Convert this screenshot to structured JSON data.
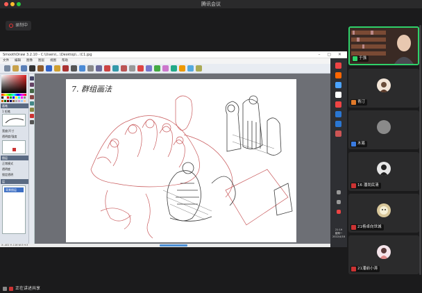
{
  "meeting": {
    "title": "腾讯会议",
    "recording_label": "录制中",
    "sharer_label": "正在讲述共享"
  },
  "smoothdraw": {
    "window_title": "SmoothDraw 3.2.10 - C:\\Users\\...\\Desktop\\...\\C1.jpg",
    "menu": [
      "文件",
      "编辑",
      "图像",
      "图层",
      "视图",
      "帮助"
    ],
    "panel": {
      "section_brush": "画笔",
      "brush_name": "1 铅笔",
      "label_size": "宽度/尺寸",
      "label_opacity": "透明度/强度",
      "section_layers": "图层",
      "layer_blend": "正常模式",
      "layer_opacity": "透明度",
      "section_layer_list": "层",
      "layer_item": "背景图层",
      "checkbox_label": "锁定透明"
    },
    "status": "X:-401 Y:-116      W:3 H:3",
    "zoom_slider": "",
    "canvas_title": "7. 群组画法"
  },
  "taskbar": {
    "clock_time": "21:19",
    "clock_day": "星期一",
    "clock_date": "2022/4/18"
  },
  "participants": [
    {
      "name": "于强",
      "active": true
    },
    {
      "name": "青汀",
      "active": false
    },
    {
      "name": "木易",
      "active": false
    },
    {
      "name": "16 潘尚民清",
      "active": false
    },
    {
      "name": "21杨卓向世城",
      "active": false
    },
    {
      "name": "21潘前小涛",
      "active": false
    }
  ],
  "colors": {
    "active_speaker_border": "#2fd26a",
    "meeting_bg": "#1b1b1c",
    "tile_bg": "#2b2b2c",
    "sketch_red": "#c8585a",
    "sketch_dark": "#3a3a3a"
  },
  "icons": [
    "record-icon",
    "mic-muted-icon",
    "share-screen-icon"
  ]
}
